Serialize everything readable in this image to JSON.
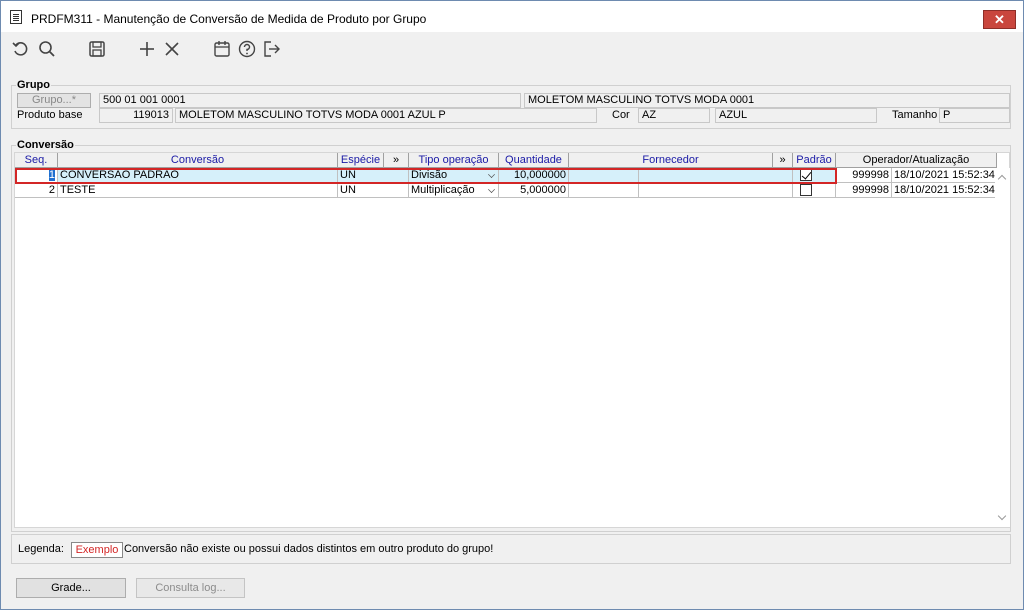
{
  "window": {
    "title": "PRDFM311 - Manutenção de Conversão de Medida de Produto por Grupo",
    "close_label": "✕"
  },
  "toolbar": {
    "icons": [
      "undo-icon",
      "search-icon",
      "save-icon",
      "add-icon",
      "delete-icon",
      "calendar-icon",
      "help-icon",
      "exit-icon"
    ]
  },
  "grupo": {
    "section_label": "Grupo",
    "grupo_button": "Grupo...*",
    "grupo_code": "500 01 001 0001",
    "grupo_desc": "MOLETOM MASCULINO TOTVS MODA 0001",
    "produto_base_label": "Produto base",
    "produto_code": "119013",
    "produto_desc": "MOLETOM MASCULINO TOTVS MODA 0001 AZUL P",
    "cor_label": "Cor",
    "cor_code": "AZ",
    "cor_desc": "AZUL",
    "tamanho_label": "Tamanho",
    "tamanho_value": "P"
  },
  "conversao": {
    "section_label": "Conversão",
    "columns": {
      "seq": "Seq.",
      "conversao": "Conversão",
      "especie": "Espécie",
      "more1": "»",
      "tipo": "Tipo operação",
      "quantidade": "Quantidade",
      "fornecedor": "Fornecedor",
      "more2": "»",
      "padrao": "Padrão",
      "operador": "Operador/Atualização"
    },
    "rows": [
      {
        "seq": "1",
        "conversao": "CONVERSAO PADRAO",
        "especie": "UN",
        "tipo": "Divisão",
        "quantidade": "10,000000",
        "forn_code": "",
        "forn_desc": "",
        "padrao": true,
        "operador": "999998",
        "atualizacao": "18/10/2021 15:52:34"
      },
      {
        "seq": "2",
        "conversao": "TESTE",
        "especie": "UN",
        "tipo": "Multiplicação",
        "quantidade": "5,000000",
        "forn_code": "",
        "forn_desc": "",
        "padrao": false,
        "operador": "999998",
        "atualizacao": "18/10/2021 15:52:34"
      }
    ]
  },
  "legend": {
    "label": "Legenda:",
    "example": "Exemplo",
    "text": "Conversão não existe ou possui dados distintos em outro produto do grupo!"
  },
  "buttons": {
    "grade": "Grade...",
    "consulta_log": "Consulta log..."
  },
  "colors": {
    "highlight_outline": "#d32626",
    "selected_row": "#d6f0fa",
    "header_text": "#1a1aa6",
    "close_button": "#c9463d"
  }
}
